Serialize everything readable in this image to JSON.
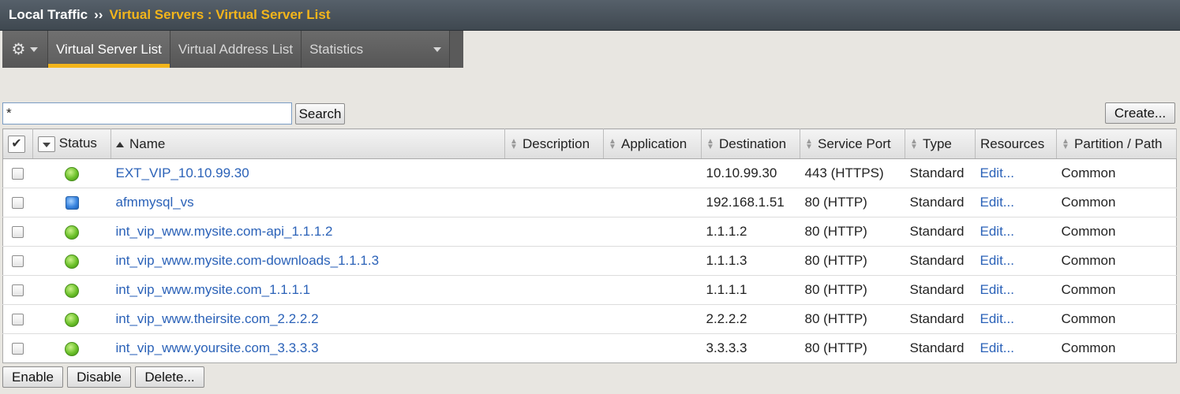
{
  "breadcrumb": {
    "root": "Local Traffic",
    "separator": "››",
    "current": "Virtual Servers : Virtual Server List"
  },
  "tabs": [
    {
      "label": "Virtual Server List",
      "active": true
    },
    {
      "label": "Virtual Address List",
      "active": false
    },
    {
      "label": "Statistics",
      "active": false
    }
  ],
  "search": {
    "value": "*",
    "button_label": "Search"
  },
  "create_label": "Create...",
  "columns": {
    "status": "Status",
    "name": "Name",
    "description": "Description",
    "application": "Application",
    "destination": "Destination",
    "service_port": "Service Port",
    "type": "Type",
    "resources": "Resources",
    "partition": "Partition / Path"
  },
  "rows": [
    {
      "status": "available",
      "name": "EXT_VIP_10.10.99.30",
      "description": "",
      "application": "",
      "destination": "10.10.99.30",
      "service_port": "443 (HTTPS)",
      "type": "Standard",
      "resources": "Edit...",
      "partition": "Common"
    },
    {
      "status": "unknown",
      "name": "afmmysql_vs",
      "description": "",
      "application": "",
      "destination": "192.168.1.51",
      "service_port": "80 (HTTP)",
      "type": "Standard",
      "resources": "Edit...",
      "partition": "Common"
    },
    {
      "status": "available",
      "name": "int_vip_www.mysite.com-api_1.1.1.2",
      "description": "",
      "application": "",
      "destination": "1.1.1.2",
      "service_port": "80 (HTTP)",
      "type": "Standard",
      "resources": "Edit...",
      "partition": "Common"
    },
    {
      "status": "available",
      "name": "int_vip_www.mysite.com-downloads_1.1.1.3",
      "description": "",
      "application": "",
      "destination": "1.1.1.3",
      "service_port": "80 (HTTP)",
      "type": "Standard",
      "resources": "Edit...",
      "partition": "Common"
    },
    {
      "status": "available",
      "name": "int_vip_www.mysite.com_1.1.1.1",
      "description": "",
      "application": "",
      "destination": "1.1.1.1",
      "service_port": "80 (HTTP)",
      "type": "Standard",
      "resources": "Edit...",
      "partition": "Common"
    },
    {
      "status": "available",
      "name": "int_vip_www.theirsite.com_2.2.2.2",
      "description": "",
      "application": "",
      "destination": "2.2.2.2",
      "service_port": "80 (HTTP)",
      "type": "Standard",
      "resources": "Edit...",
      "partition": "Common"
    },
    {
      "status": "available",
      "name": "int_vip_www.yoursite.com_3.3.3.3",
      "description": "",
      "application": "",
      "destination": "3.3.3.3",
      "service_port": "80 (HTTP)",
      "type": "Standard",
      "resources": "Edit...",
      "partition": "Common"
    }
  ],
  "actions": {
    "enable": "Enable",
    "disable": "Disable",
    "delete": "Delete..."
  },
  "colors": {
    "accent": "#f3b51b",
    "link": "#2b62b8",
    "status_available": "#6cc12a",
    "status_unknown": "#3b86e0"
  }
}
